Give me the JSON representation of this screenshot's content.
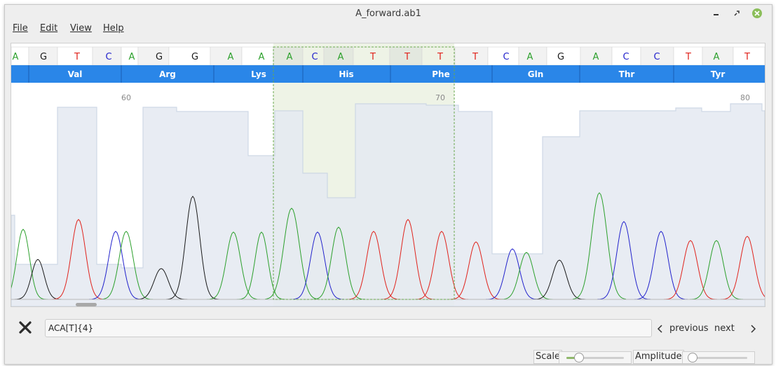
{
  "window": {
    "title": "A_forward.ab1"
  },
  "menu": {
    "file": "File",
    "edit": "Edit",
    "view": "View",
    "help": "Help"
  },
  "sequence": {
    "bases": [
      "A",
      "G",
      "T",
      "C",
      "A",
      "G",
      "G",
      "A",
      "A",
      "A",
      "C",
      "A",
      "T",
      "T",
      "T",
      "T",
      "C",
      "A",
      "G",
      "A",
      "C",
      "C",
      "T",
      "A",
      "T"
    ],
    "base_colors": {
      "A": "#2ca02c",
      "G": "#1a1a1a",
      "T": "#e0231c",
      "C": "#2222cc"
    },
    "selected_range": [
      9,
      15
    ],
    "amino_acids": [
      "Val",
      "Arg",
      "Lys",
      "His",
      "Phe",
      "Gln",
      "Thr",
      "Tyr"
    ],
    "position_ticks": [
      "60",
      "70",
      "80"
    ]
  },
  "search": {
    "value": "ACA[T]{4}",
    "placeholder": ""
  },
  "nav": {
    "previous": "previous",
    "next": "next"
  },
  "controls": {
    "scale_label": "Scale",
    "amplitude_label": "Amplitude",
    "scale_value": 0.22,
    "amplitude_value": 0.05
  },
  "colors": {
    "accent": "#1a73d9",
    "amino_bar": "#2a86e8",
    "quality": "#e6ebf2",
    "selection": "#eef3e6"
  }
}
